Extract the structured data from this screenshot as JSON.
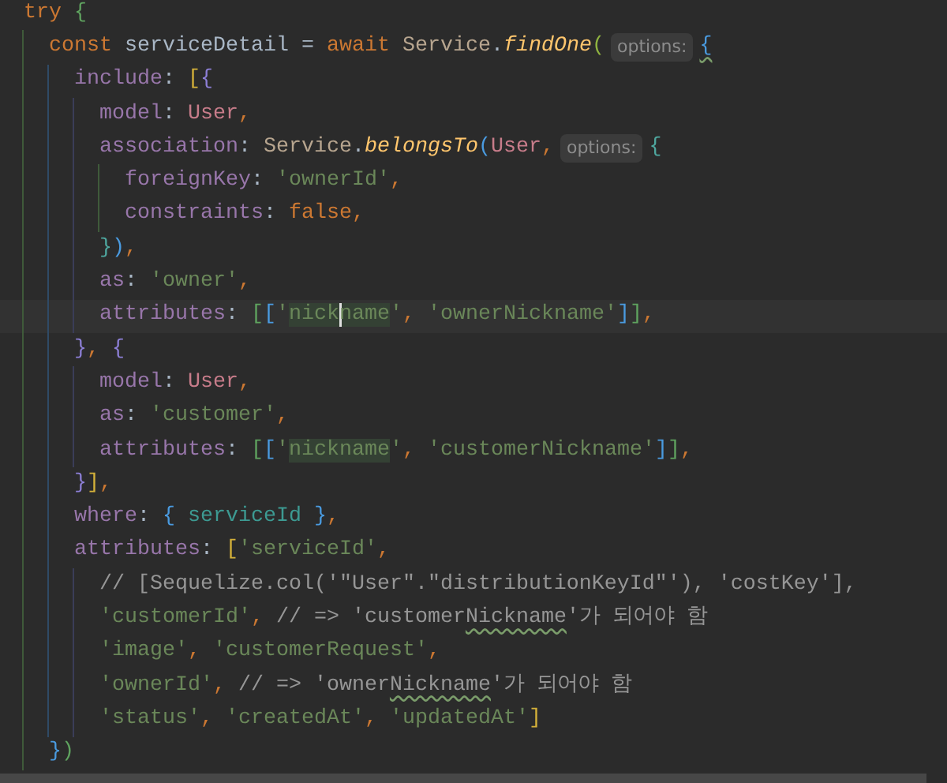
{
  "editor": {
    "lines": [
      {
        "tokens": [
          {
            "text": "try ",
            "kind": "keyword"
          },
          {
            "text": "{",
            "kind": "bracket",
            "color": "#5fa35f"
          }
        ],
        "children": [
          {
            "tokens": [
              {
                "text": "const ",
                "kind": "keyword"
              },
              {
                "text": "serviceDetail = ",
                "kind": "plain"
              },
              {
                "text": "await ",
                "kind": "keyword"
              },
              {
                "text": "Service",
                "kind": "class"
              },
              {
                "text": ".",
                "kind": "plain"
              },
              {
                "text": "findOne",
                "kind": "method"
              },
              {
                "text": "(",
                "kind": "bracket",
                "color": "#8fb340"
              },
              {
                "text": "options:",
                "kind": "hint"
              },
              {
                "text": "{",
                "kind": "bracket",
                "color": "#4a9be0",
                "squiggle": true
              }
            ],
            "children": [
              {
                "tokens": [
                  {
                    "text": "include",
                    "kind": "prop"
                  },
                  {
                    "text": ": ",
                    "kind": "plain"
                  },
                  {
                    "text": "[",
                    "kind": "bracket",
                    "color": "#d4b13a"
                  },
                  {
                    "text": "{",
                    "kind": "bracket",
                    "color": "#8d7fd6"
                  }
                ],
                "children": [
                  {
                    "tokens": [
                      {
                        "text": "model",
                        "kind": "prop"
                      },
                      {
                        "text": ": ",
                        "kind": "plain"
                      },
                      {
                        "text": "User",
                        "kind": "model"
                      },
                      {
                        "text": ",",
                        "kind": "punct"
                      }
                    ]
                  },
                  {
                    "tokens": [
                      {
                        "text": "association",
                        "kind": "prop"
                      },
                      {
                        "text": ": ",
                        "kind": "plain"
                      },
                      {
                        "text": "Service",
                        "kind": "class"
                      },
                      {
                        "text": ".",
                        "kind": "plain"
                      },
                      {
                        "text": "belongsTo",
                        "kind": "method"
                      },
                      {
                        "text": "(",
                        "kind": "bracket",
                        "color": "#4a9be0"
                      },
                      {
                        "text": "User",
                        "kind": "model"
                      },
                      {
                        "text": ",",
                        "kind": "punct"
                      },
                      {
                        "text": "options:",
                        "kind": "hint"
                      },
                      {
                        "text": "{",
                        "kind": "bracket",
                        "color": "#4fa8a0"
                      }
                    ],
                    "children": [
                      {
                        "tokens": [
                          {
                            "text": "foreignKey",
                            "kind": "prop"
                          },
                          {
                            "text": ": ",
                            "kind": "plain"
                          },
                          {
                            "text": "'ownerId'",
                            "kind": "string"
                          },
                          {
                            "text": ",",
                            "kind": "punct"
                          }
                        ]
                      },
                      {
                        "tokens": [
                          {
                            "text": "constraints",
                            "kind": "prop"
                          },
                          {
                            "text": ": ",
                            "kind": "plain"
                          },
                          {
                            "text": "false",
                            "kind": "keyword"
                          },
                          {
                            "text": ",",
                            "kind": "punct"
                          }
                        ]
                      }
                    ]
                  },
                  {
                    "tokens": [
                      {
                        "text": "}",
                        "kind": "bracket",
                        "color": "#4fa8a0"
                      },
                      {
                        "text": ")",
                        "kind": "bracket",
                        "color": "#4a9be0"
                      },
                      {
                        "text": ",",
                        "kind": "punct"
                      }
                    ]
                  },
                  {
                    "tokens": [
                      {
                        "text": "as",
                        "kind": "prop"
                      },
                      {
                        "text": ": ",
                        "kind": "plain"
                      },
                      {
                        "text": "'owner'",
                        "kind": "string"
                      },
                      {
                        "text": ",",
                        "kind": "punct"
                      }
                    ]
                  },
                  {
                    "current": true,
                    "tokens": [
                      {
                        "text": "attributes",
                        "kind": "prop"
                      },
                      {
                        "text": ": ",
                        "kind": "plain"
                      },
                      {
                        "text": "[",
                        "kind": "bracket",
                        "color": "#5fa35f"
                      },
                      {
                        "text": "[",
                        "kind": "bracket",
                        "color": "#4a9be0"
                      },
                      {
                        "text": "'",
                        "kind": "string"
                      },
                      {
                        "text": "nick",
                        "kind": "match"
                      },
                      {
                        "text": "name",
                        "kind": "match",
                        "caret": true
                      },
                      {
                        "text": "'",
                        "kind": "string"
                      },
                      {
                        "text": ", ",
                        "kind": "punct"
                      },
                      {
                        "text": "'ownerNickname'",
                        "kind": "string"
                      },
                      {
                        "text": "]",
                        "kind": "bracket",
                        "color": "#4a9be0"
                      },
                      {
                        "text": "]",
                        "kind": "bracket",
                        "color": "#5fa35f"
                      },
                      {
                        "text": ",",
                        "kind": "punct"
                      }
                    ]
                  }
                ]
              },
              {
                "tokens": [
                  {
                    "text": "}",
                    "kind": "bracket",
                    "color": "#8d7fd6"
                  },
                  {
                    "text": ", ",
                    "kind": "punct"
                  },
                  {
                    "text": "{",
                    "kind": "bracket",
                    "color": "#8d7fd6"
                  }
                ],
                "children": [
                  {
                    "tokens": [
                      {
                        "text": "model",
                        "kind": "prop"
                      },
                      {
                        "text": ": ",
                        "kind": "plain"
                      },
                      {
                        "text": "User",
                        "kind": "model"
                      },
                      {
                        "text": ",",
                        "kind": "punct"
                      }
                    ]
                  },
                  {
                    "tokens": [
                      {
                        "text": "as",
                        "kind": "prop"
                      },
                      {
                        "text": ": ",
                        "kind": "plain"
                      },
                      {
                        "text": "'customer'",
                        "kind": "string"
                      },
                      {
                        "text": ",",
                        "kind": "punct"
                      }
                    ]
                  },
                  {
                    "tokens": [
                      {
                        "text": "attributes",
                        "kind": "prop"
                      },
                      {
                        "text": ": ",
                        "kind": "plain"
                      },
                      {
                        "text": "[",
                        "kind": "bracket",
                        "color": "#5fa35f"
                      },
                      {
                        "text": "[",
                        "kind": "bracket",
                        "color": "#4a9be0"
                      },
                      {
                        "text": "'",
                        "kind": "string"
                      },
                      {
                        "text": "nickname",
                        "kind": "match"
                      },
                      {
                        "text": "'",
                        "kind": "string"
                      },
                      {
                        "text": ", ",
                        "kind": "punct"
                      },
                      {
                        "text": "'customerNickname'",
                        "kind": "string"
                      },
                      {
                        "text": "]",
                        "kind": "bracket",
                        "color": "#4a9be0"
                      },
                      {
                        "text": "]",
                        "kind": "bracket",
                        "color": "#5fa35f"
                      },
                      {
                        "text": ",",
                        "kind": "punct"
                      }
                    ]
                  }
                ]
              },
              {
                "tokens": [
                  {
                    "text": "}",
                    "kind": "bracket",
                    "color": "#8d7fd6"
                  },
                  {
                    "text": "]",
                    "kind": "bracket",
                    "color": "#d4b13a"
                  },
                  {
                    "text": ",",
                    "kind": "punct"
                  }
                ]
              },
              {
                "tokens": [
                  {
                    "text": "where",
                    "kind": "prop"
                  },
                  {
                    "text": ": ",
                    "kind": "plain"
                  },
                  {
                    "text": "{",
                    "kind": "bracket",
                    "color": "#4a9be0"
                  },
                  {
                    "text": " serviceId ",
                    "kind": "shorthand"
                  },
                  {
                    "text": "}",
                    "kind": "bracket",
                    "color": "#4a9be0"
                  },
                  {
                    "text": ",",
                    "kind": "punct"
                  }
                ]
              },
              {
                "tokens": [
                  {
                    "text": "attributes",
                    "kind": "prop"
                  },
                  {
                    "text": ": ",
                    "kind": "plain"
                  },
                  {
                    "text": "[",
                    "kind": "bracket",
                    "color": "#d4b13a"
                  },
                  {
                    "text": "'serviceId'",
                    "kind": "string"
                  },
                  {
                    "text": ",",
                    "kind": "punct"
                  }
                ],
                "children": [
                  {
                    "tokens": [
                      {
                        "text": "// [Sequelize.col('\"User\".\"distributionKeyId\"'), 'costKey'],",
                        "kind": "comment"
                      }
                    ]
                  },
                  {
                    "tokens": [
                      {
                        "text": "'customerId'",
                        "kind": "string"
                      },
                      {
                        "text": ", ",
                        "kind": "punct"
                      },
                      {
                        "text": "// => 'customer",
                        "kind": "comment"
                      },
                      {
                        "text": "Nickname",
                        "kind": "comment",
                        "squiggle": true
                      },
                      {
                        "text": "'가 되어야 함",
                        "kind": "comment"
                      }
                    ]
                  },
                  {
                    "tokens": [
                      {
                        "text": "'image'",
                        "kind": "string"
                      },
                      {
                        "text": ", ",
                        "kind": "punct"
                      },
                      {
                        "text": "'customerRequest'",
                        "kind": "string"
                      },
                      {
                        "text": ",",
                        "kind": "punct"
                      }
                    ]
                  },
                  {
                    "tokens": [
                      {
                        "text": "'ownerId'",
                        "kind": "string"
                      },
                      {
                        "text": ", ",
                        "kind": "punct"
                      },
                      {
                        "text": "// => 'owner",
                        "kind": "comment"
                      },
                      {
                        "text": "Nickname",
                        "kind": "comment",
                        "squiggle": true
                      },
                      {
                        "text": "'가 되어야 함",
                        "kind": "comment"
                      }
                    ]
                  },
                  {
                    "tokens": [
                      {
                        "text": "'status'",
                        "kind": "string"
                      },
                      {
                        "text": ", ",
                        "kind": "punct"
                      },
                      {
                        "text": "'createdAt'",
                        "kind": "string"
                      },
                      {
                        "text": ", ",
                        "kind": "punct"
                      },
                      {
                        "text": "'updatedAt'",
                        "kind": "string"
                      },
                      {
                        "text": "]",
                        "kind": "bracket",
                        "color": "#d4b13a"
                      }
                    ]
                  }
                ]
              }
            ]
          },
          {
            "tokens": [
              {
                "text": "}",
                "kind": "bracket",
                "color": "#4a9be0"
              },
              {
                "text": ")",
                "kind": "bracket",
                "color": "#5fa35f"
              }
            ]
          }
        ]
      }
    ]
  }
}
